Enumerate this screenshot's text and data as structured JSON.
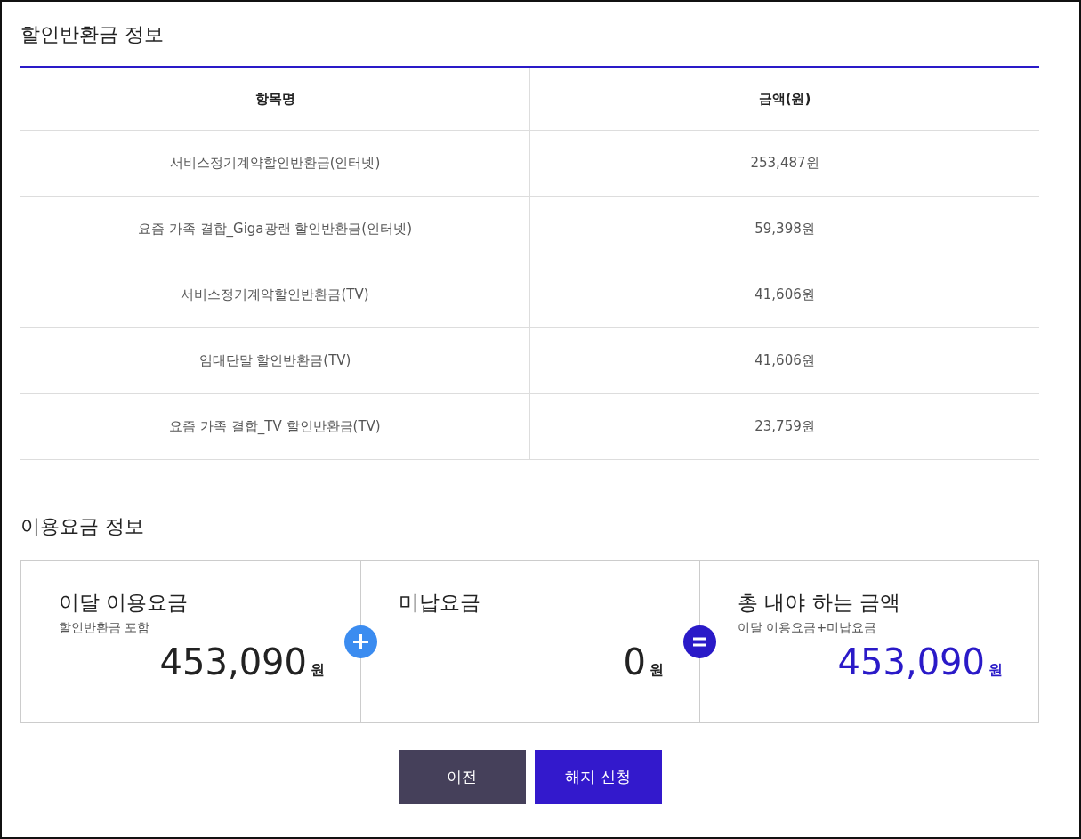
{
  "refund_section": {
    "title": "할인반환금 정보",
    "table": {
      "columns": [
        "항목명",
        "금액(원)"
      ],
      "rows": [
        [
          "서비스정기계약할인반환금(인터넷)",
          "253,487원"
        ],
        [
          "요즘 가족 결합_Giga광랜 할인반환금(인터넷)",
          "59,398원"
        ],
        [
          "서비스정기계약할인반환금(TV)",
          "41,606원"
        ],
        [
          "임대단말 할인반환금(TV)",
          "41,606원"
        ],
        [
          "요즘 가족 결합_TV 할인반환금(TV)",
          "23,759원"
        ]
      ]
    }
  },
  "fee_section": {
    "title": "이용요금 정보",
    "cards": [
      {
        "kind": "normal",
        "title": "이달 이용요금",
        "subtitle": "할인반환금 포함",
        "amount": "453,090",
        "unit": "원",
        "operator": {
          "kind": "plus"
        }
      },
      {
        "kind": "normal",
        "title": "미납요금",
        "amount": "0",
        "unit": "원",
        "operator": {
          "kind": "equals"
        }
      },
      {
        "kind": "total",
        "title": "총 내야 하는 금액",
        "subtitle": "이달 이용요금+미납요금",
        "amount": "453,090",
        "unit": "원"
      }
    ]
  },
  "buttons": [
    {
      "kind": "secondary",
      "label": "이전"
    },
    {
      "kind": "primary",
      "label": "해지 신청"
    }
  ]
}
